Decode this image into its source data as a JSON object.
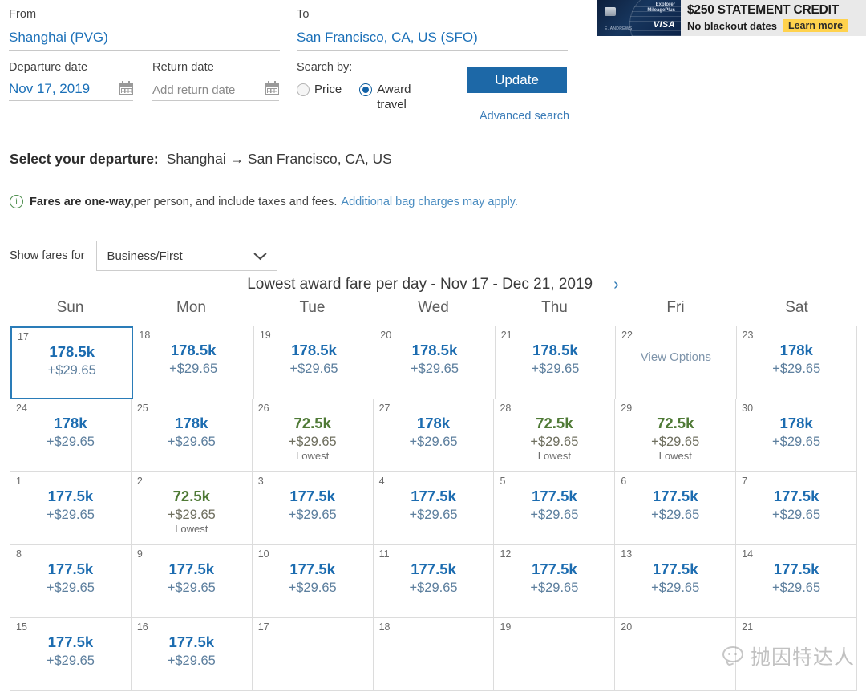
{
  "search": {
    "from_label": "From",
    "from_value": "Shanghai (PVG)",
    "to_label": "To",
    "to_value": "San Francisco, CA, US (SFO)",
    "departure_label": "Departure date",
    "departure_value": "Nov 17, 2019",
    "return_label": "Return date",
    "return_placeholder": "Add return date",
    "searchby_label": "Search by:",
    "option_price": "Price",
    "option_award": "Award travel",
    "selected_option": "Award travel",
    "update_label": "Update",
    "advanced_search_label": "Advanced search"
  },
  "ad": {
    "headline": "$250 STATEMENT CREDIT",
    "subline": "No blackout dates",
    "cta": "Learn more",
    "card_brand": "Explorer",
    "card_brand2": "MileagePlus",
    "card_network": "VISA",
    "card_name": "E. ANDREWS"
  },
  "departure": {
    "label": "Select your departure:",
    "route": "Shanghai → San Francisco, CA, US"
  },
  "notice": {
    "strong": "Fares are one-way,",
    "rest": " per person, and include taxes and fees.",
    "link": "Additional bag charges may apply."
  },
  "cabin": {
    "label": "Show fares for",
    "value": "Business/First",
    "chevron_icon": "chevron-down-icon"
  },
  "calendar": {
    "title": "Lowest award fare per day - Nov 17 - Dec 21, 2019",
    "next_icon": "›",
    "weekdays": [
      "Sun",
      "Mon",
      "Tue",
      "Wed",
      "Thu",
      "Fri",
      "Sat"
    ],
    "lowest_tag": "Lowest",
    "view_options_label": "View Options",
    "rows": [
      [
        {
          "day": "17",
          "miles": "178.5k",
          "taxes": "+$29.65",
          "lowest": false,
          "selected": true
        },
        {
          "day": "18",
          "miles": "178.5k",
          "taxes": "+$29.65",
          "lowest": false,
          "selected": false
        },
        {
          "day": "19",
          "miles": "178.5k",
          "taxes": "+$29.65",
          "lowest": false,
          "selected": false
        },
        {
          "day": "20",
          "miles": "178.5k",
          "taxes": "+$29.65",
          "lowest": false,
          "selected": false
        },
        {
          "day": "21",
          "miles": "178.5k",
          "taxes": "+$29.65",
          "lowest": false,
          "selected": false
        },
        {
          "day": "22",
          "view_options": true
        },
        {
          "day": "23",
          "miles": "178k",
          "taxes": "+$29.65",
          "lowest": false,
          "selected": false
        }
      ],
      [
        {
          "day": "24",
          "miles": "178k",
          "taxes": "+$29.65",
          "lowest": false,
          "selected": false
        },
        {
          "day": "25",
          "miles": "178k",
          "taxes": "+$29.65",
          "lowest": false,
          "selected": false
        },
        {
          "day": "26",
          "miles": "72.5k",
          "taxes": "+$29.65",
          "lowest": true,
          "selected": false
        },
        {
          "day": "27",
          "miles": "178k",
          "taxes": "+$29.65",
          "lowest": false,
          "selected": false
        },
        {
          "day": "28",
          "miles": "72.5k",
          "taxes": "+$29.65",
          "lowest": true,
          "selected": false
        },
        {
          "day": "29",
          "miles": "72.5k",
          "taxes": "+$29.65",
          "lowest": true,
          "selected": false
        },
        {
          "day": "30",
          "miles": "178k",
          "taxes": "+$29.65",
          "lowest": false,
          "selected": false
        }
      ],
      [
        {
          "day": "1",
          "miles": "177.5k",
          "taxes": "+$29.65",
          "lowest": false,
          "selected": false
        },
        {
          "day": "2",
          "miles": "72.5k",
          "taxes": "+$29.65",
          "lowest": true,
          "selected": false
        },
        {
          "day": "3",
          "miles": "177.5k",
          "taxes": "+$29.65",
          "lowest": false,
          "selected": false
        },
        {
          "day": "4",
          "miles": "177.5k",
          "taxes": "+$29.65",
          "lowest": false,
          "selected": false
        },
        {
          "day": "5",
          "miles": "177.5k",
          "taxes": "+$29.65",
          "lowest": false,
          "selected": false
        },
        {
          "day": "6",
          "miles": "177.5k",
          "taxes": "+$29.65",
          "lowest": false,
          "selected": false
        },
        {
          "day": "7",
          "miles": "177.5k",
          "taxes": "+$29.65",
          "lowest": false,
          "selected": false
        }
      ],
      [
        {
          "day": "8",
          "miles": "177.5k",
          "taxes": "+$29.65",
          "lowest": false,
          "selected": false
        },
        {
          "day": "9",
          "miles": "177.5k",
          "taxes": "+$29.65",
          "lowest": false,
          "selected": false
        },
        {
          "day": "10",
          "miles": "177.5k",
          "taxes": "+$29.65",
          "lowest": false,
          "selected": false
        },
        {
          "day": "11",
          "miles": "177.5k",
          "taxes": "+$29.65",
          "lowest": false,
          "selected": false
        },
        {
          "day": "12",
          "miles": "177.5k",
          "taxes": "+$29.65",
          "lowest": false,
          "selected": false
        },
        {
          "day": "13",
          "miles": "177.5k",
          "taxes": "+$29.65",
          "lowest": false,
          "selected": false
        },
        {
          "day": "14",
          "miles": "177.5k",
          "taxes": "+$29.65",
          "lowest": false,
          "selected": false
        }
      ],
      [
        {
          "day": "15",
          "miles": "177.5k",
          "taxes": "+$29.65",
          "lowest": false,
          "selected": false
        },
        {
          "day": "16",
          "miles": "177.5k",
          "taxes": "+$29.65",
          "lowest": false,
          "selected": false
        },
        {
          "day": "17",
          "empty": true
        },
        {
          "day": "18",
          "empty": true
        },
        {
          "day": "19",
          "empty": true
        },
        {
          "day": "20",
          "empty": true
        },
        {
          "day": "21",
          "empty": true
        }
      ]
    ]
  },
  "watermark": {
    "text": "抛因特达人"
  },
  "colors": {
    "accent_blue": "#1d68a7",
    "miles_blue": "#1c6cb0",
    "lowest_green": "#4f7a36",
    "link_blue": "#3b7cb8",
    "selected_border": "#2a7cb8",
    "ad_yellow": "#ffd24d"
  }
}
